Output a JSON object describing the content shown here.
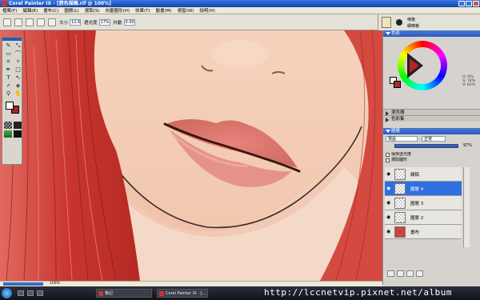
{
  "window": {
    "title": "Corel Painter IX - [唇色描稿.rif @ 100%]"
  },
  "menu": [
    "檔案(F)",
    "編輯(E)",
    "畫布(C)",
    "圖層(L)",
    "選取(S)",
    "向量圖形(H)",
    "效果(T)",
    "動畫(M)",
    "視窗(W)",
    "說明(H)"
  ],
  "propbar": {
    "size_label": "大小",
    "size_value": "12.6",
    "opacity_label": "透光度",
    "opacity_value": "17%",
    "resat_label": "抖動",
    "resat_value": "0.00"
  },
  "brush": {
    "category": "噴槍",
    "variant": "細噴槍"
  },
  "color_panel": {
    "title": "色彩",
    "h": "H: 0%",
    "s": "S: 74%",
    "v": "V: 62%"
  },
  "mixer_panel": {
    "title": "混色器"
  },
  "colorset_panel": {
    "title": "色彩集"
  },
  "layers_panel": {
    "title": "圖層",
    "composite": "預設",
    "mode": "正常",
    "opacity": "97%",
    "check1": "保持透光度",
    "check2": "選取圖形",
    "layers": [
      {
        "name": "線稿",
        "active": false
      },
      {
        "name": "圖層 4",
        "active": true
      },
      {
        "name": "圖層 3",
        "active": false
      },
      {
        "name": "圖層 2",
        "active": false
      },
      {
        "name": "畫布",
        "active": false
      }
    ]
  },
  "status": {
    "zoom": "100%"
  },
  "taskbar": {
    "task1": "筆記",
    "task2": "Corel Painter IX - [...",
    "url": "http://lccnetvip.pixnet.net/album"
  },
  "colors": {
    "title_blue": "#2d5bbf",
    "skin": "#f2cbb5",
    "hair": "#d2453c",
    "lip": "#d4706a"
  }
}
